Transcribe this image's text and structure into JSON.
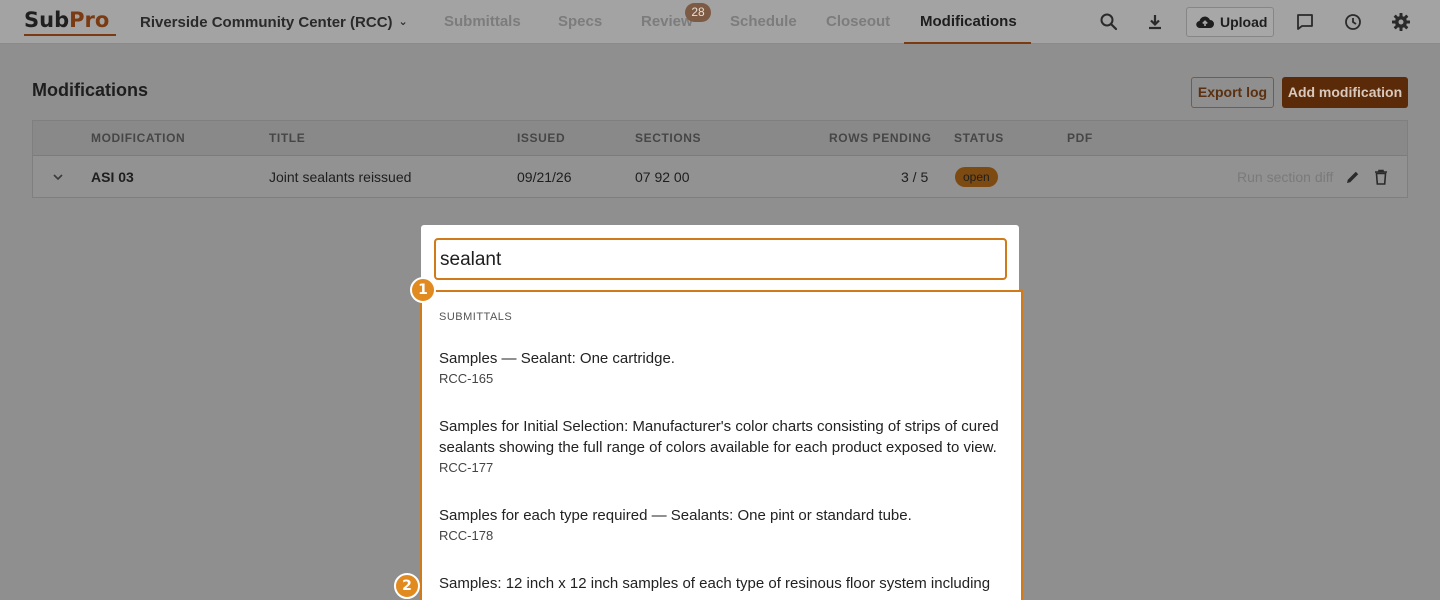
{
  "brand": {
    "logo_part1": "Sub",
    "logo_part2": "Pro"
  },
  "header": {
    "project": "Riverside Community Center (RCC)",
    "nav": [
      "Submittals",
      "Specs",
      "Review",
      "Schedule",
      "Closeout",
      "Modifications"
    ],
    "active_nav": "Modifications",
    "review_badge": "28",
    "upload_label": "Upload"
  },
  "page": {
    "title": "Modifications",
    "export_label": "Export log",
    "add_label": "Add modification"
  },
  "table": {
    "columns": [
      "MODIFICATION",
      "TITLE",
      "ISSUED",
      "SECTIONS",
      "ROWS PENDING",
      "STATUS",
      "PDF"
    ],
    "rows": [
      {
        "modification": "ASI 03",
        "title": "Joint sealants reissued",
        "issued": "09/21/26",
        "sections": "07 92 00",
        "rows_pending": "3 / 5",
        "status": "open",
        "action": "Run section diff"
      }
    ]
  },
  "search": {
    "value": "sealant",
    "section_label": "SUBMITTALS",
    "results": [
      {
        "title": "Samples — Sealant: One cartridge.",
        "code": "RCC-165"
      },
      {
        "title": "Samples for Initial Selection: Manufacturer's color charts consisting of strips of cured sealants showing the full range of colors available for each product exposed to view.",
        "code": "RCC-177"
      },
      {
        "title": "Samples for each type required — Sealants: One pint or standard tube.",
        "code": "RCC-178"
      },
      {
        "title": "Samples: 12 inch x 12 inch samples of each type of resinous floor system including",
        "code": ""
      }
    ]
  },
  "markers": [
    "1",
    "2"
  ],
  "colors": {
    "accent": "#d07a1a",
    "brand": "#7a3a12",
    "primary_btn": "#5b2a08"
  }
}
